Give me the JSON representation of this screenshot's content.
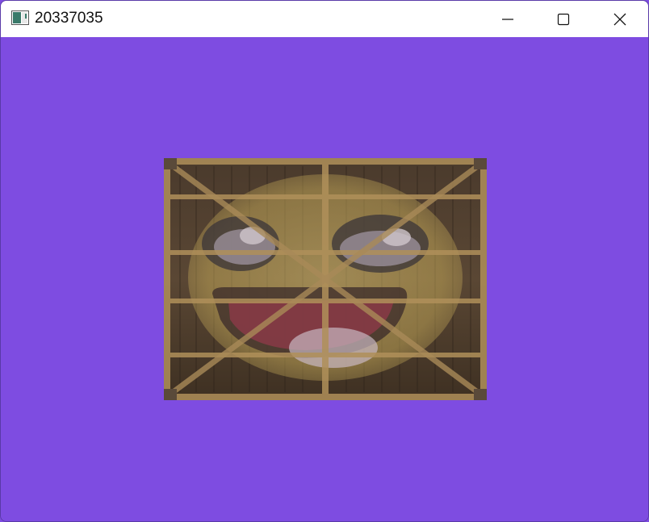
{
  "window": {
    "title": "20337035",
    "app_icon": "app-window-icon",
    "controls": {
      "minimize": "minimize-icon",
      "maximize": "maximize-icon",
      "close": "close-icon"
    }
  },
  "scene": {
    "clear_color": "#7e4ce1",
    "textures": [
      "wooden-container-texture",
      "awesomeface-texture"
    ],
    "blend": "mixed"
  }
}
